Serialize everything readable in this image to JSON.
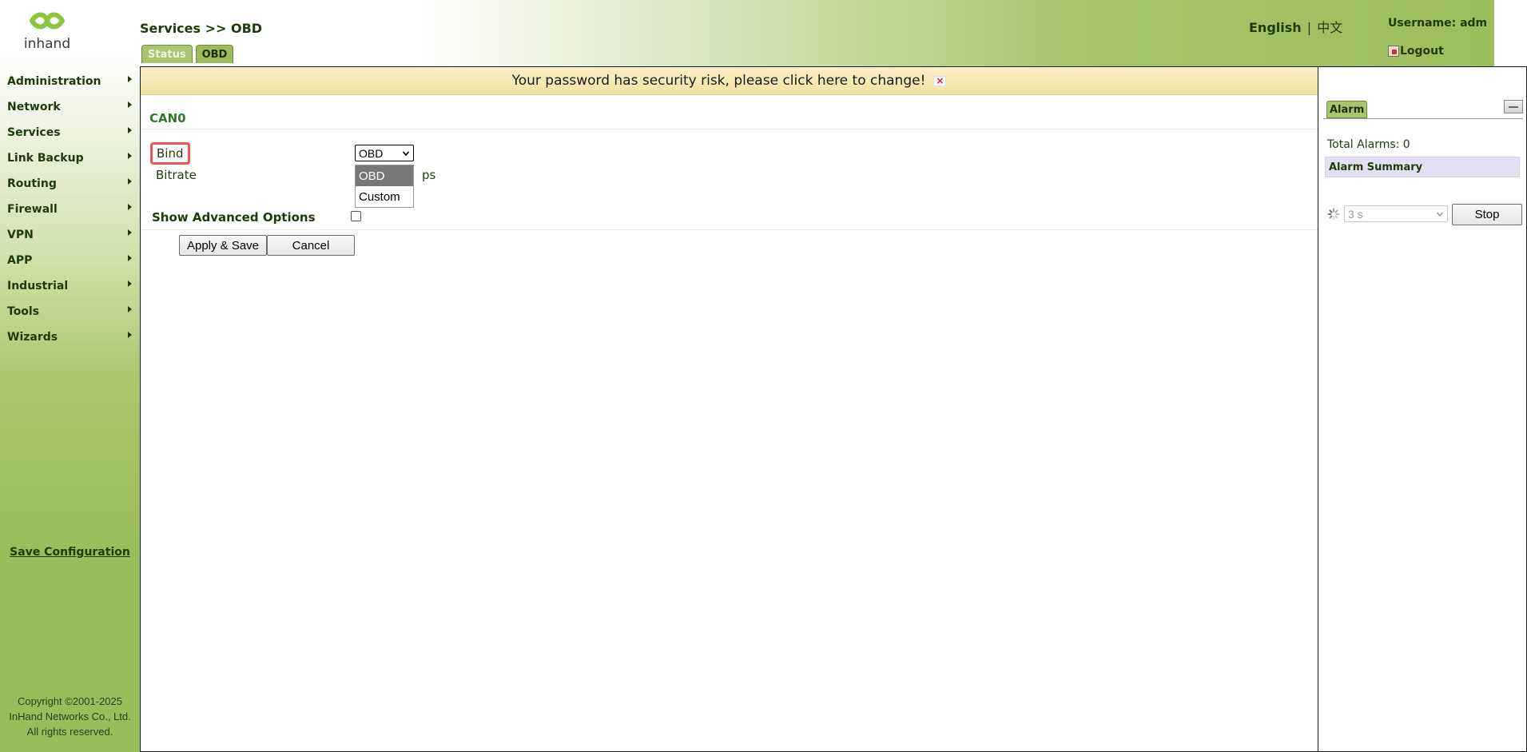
{
  "brand": {
    "logo_text": "inhand"
  },
  "header": {
    "breadcrumb": "Services >> OBD",
    "tabs": [
      {
        "label": "Status",
        "active": false
      },
      {
        "label": "OBD",
        "active": true
      }
    ],
    "lang_en": "English",
    "lang_sep": "|",
    "lang_zh": "中文",
    "username": "Username: adm",
    "logout": "Logout"
  },
  "sidebar": {
    "items": [
      {
        "label": "Administration"
      },
      {
        "label": "Network"
      },
      {
        "label": "Services"
      },
      {
        "label": "Link Backup"
      },
      {
        "label": "Routing"
      },
      {
        "label": "Firewall"
      },
      {
        "label": "VPN"
      },
      {
        "label": "APP"
      },
      {
        "label": "Industrial"
      },
      {
        "label": "Tools"
      },
      {
        "label": "Wizards"
      }
    ],
    "save_config": "Save Configuration",
    "copyright_line1": "Copyright ©2001-2025",
    "copyright_line2": "InHand Networks Co., Ltd.",
    "copyright_line3": "All rights reserved."
  },
  "main": {
    "warning": "Your password has security risk, please click here to change!",
    "warning_close": "×",
    "section_title": "CAN0",
    "bind_label": "Bind",
    "bind_value": "OBD",
    "bind_options": [
      "OBD",
      "Custom"
    ],
    "bitrate_label": "Bitrate",
    "bitrate_unit_visible": "ps",
    "advanced_label": "Show Advanced Options",
    "advanced_checked": false,
    "apply_button": "Apply & Save",
    "cancel_button": "Cancel"
  },
  "alarm": {
    "tab_label": "Alarm",
    "total_alarms": "Total Alarms: 0",
    "summary_label": "Alarm Summary",
    "refresh_value": "3 s",
    "stop_button": "Stop"
  },
  "colors": {
    "accent_green": "#9dbb5c",
    "title_green": "#2d7a2d",
    "text_dark": "#1e3a0a",
    "warning_bg": "#f3e2a4",
    "highlight_red": "#f05555"
  }
}
